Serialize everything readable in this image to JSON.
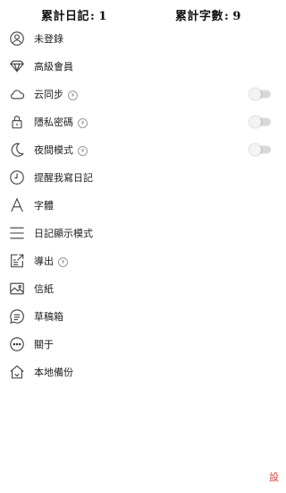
{
  "stats": {
    "diary_count_label": "累計日記",
    "diary_count_value": "1",
    "word_count_label": "累計字數",
    "word_count_value": "9",
    "separator": ":"
  },
  "menu": {
    "items": [
      {
        "label": "未登錄",
        "icon": "user-icon"
      },
      {
        "label": "高級會員",
        "icon": "diamond-icon"
      },
      {
        "label": "云同步",
        "icon": "cloud-icon",
        "vip": "¥",
        "toggle": false
      },
      {
        "label": "隱私密碼",
        "icon": "lock-icon",
        "vip": "¥",
        "toggle": false
      },
      {
        "label": "夜間模式",
        "icon": "moon-icon",
        "vip": "¥",
        "toggle": false
      },
      {
        "label": "提醒我寫日記",
        "icon": "clock-icon"
      },
      {
        "label": "字體",
        "icon": "font-icon"
      },
      {
        "label": "日記顯示模式",
        "icon": "list-icon"
      },
      {
        "label": "導出",
        "icon": "export-icon",
        "vip": "¥"
      },
      {
        "label": "信紙",
        "icon": "image-icon"
      },
      {
        "label": "草稿箱",
        "icon": "draft-icon"
      },
      {
        "label": "關于",
        "icon": "more-icon"
      },
      {
        "label": "本地備份",
        "icon": "home-backup-icon"
      }
    ]
  },
  "footer": {
    "settings_label": "設"
  },
  "colors": {
    "toggle_off": "#d9d9d9",
    "accent_red": "#d64541"
  }
}
